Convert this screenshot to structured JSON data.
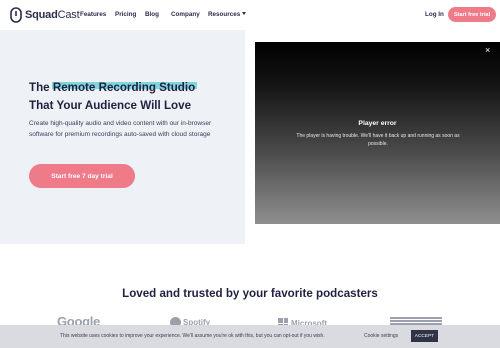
{
  "nav": {
    "logo_brand": "Squad",
    "logo_suffix": "Cast",
    "links": [
      "Features",
      "Pricing",
      "Blog",
      "Company",
      "Resources"
    ],
    "login": "Log In",
    "cta": "Start free trial"
  },
  "hero": {
    "headline_pre": "The ",
    "headline_highlight": "Remote Recording Studio",
    "headline_post": "That Your Audience Will Love",
    "subtext": "Create high-quality audio and video content with our in-browser software for premium recordings auto-saved with cloud storage",
    "cta": "Start free 7 day trial"
  },
  "player": {
    "title": "Player error",
    "message": "The player is having trouble. We'll have it back up and running as soon as possible.",
    "close": "×"
  },
  "trusted": {
    "title": "Loved and trusted by your favorite podcasters",
    "brands": [
      "Google",
      "Spotify",
      "Microsoft"
    ]
  },
  "cookie": {
    "text": "This website uses cookies to improve your experience. We'll assume you're ok with this, but you can opt-out if you wish.",
    "settings": "Cookie settings",
    "accept": "ACCEPT"
  },
  "colors": {
    "accent": "#ef7a88",
    "highlight": "#7fd6dc",
    "hero_bg": "#eef1f6",
    "text": "#1f2140"
  }
}
